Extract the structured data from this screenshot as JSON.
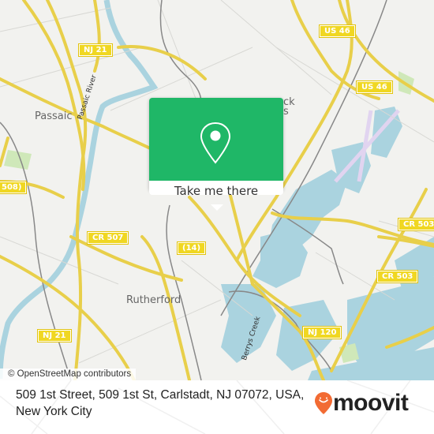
{
  "map": {
    "place_labels": {
      "passaic": "Passaic",
      "rutherford": "Rutherford",
      "hasbrouck_partial": "ck\ns"
    },
    "water_labels": {
      "passaic_river": "Passaic River",
      "berrys_creek": "Berrys Creek"
    },
    "road_shields": {
      "nj21_top": "NJ 21",
      "nj21_bottom": "NJ 21",
      "us46_top": "US 46",
      "us46_right": "US 46",
      "cr507": "CR 507",
      "rt14": "(14)",
      "cr503_top": "CR 503",
      "cr503_bottom": "CR 503",
      "nj120": "NJ 120",
      "cr508_partial": "508)"
    },
    "attribution": "© OpenStreetMap contributors"
  },
  "popup": {
    "button_label": "Take me there",
    "icon": "map-pin-icon"
  },
  "footer": {
    "address": "509 1st Street, 509 1st St, Carlstadt, NJ 07072, USA, New York City",
    "brand": "moovit"
  },
  "colors": {
    "popup_green": "#1fb767",
    "water": "#aad3df",
    "road": "#f7e16b",
    "shield": "#f0d722",
    "moovit_orange": "#f26b33"
  }
}
